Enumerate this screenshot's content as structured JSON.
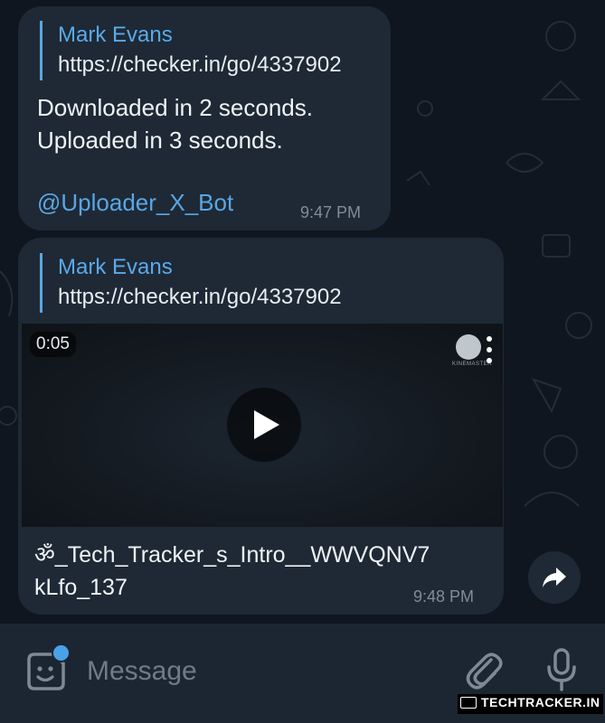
{
  "messages": [
    {
      "reply_name": "Mark Evans",
      "reply_link": "https://checker.in/go/4337902",
      "text": "Downloaded in 2 seconds.\nUploaded in 3 seconds.",
      "mention": "@Uploader_X_Bot",
      "time": "9:47 PM"
    },
    {
      "reply_name": "Mark Evans",
      "reply_link": "https://checker.in/go/4337902",
      "video": {
        "duration": "0:05",
        "watermark": "KINEMASTER",
        "icon": "play-icon"
      },
      "caption": "ॐ_Tech_Tracker_s_Intro__WWVQNV7\nkLfo_137",
      "time": "9:48 PM"
    }
  ],
  "composer": {
    "placeholder": "Message",
    "icons": [
      "sticker-icon",
      "attach-icon",
      "mic-icon"
    ]
  },
  "watermark": "TECHTRACKER.IN",
  "colors": {
    "background": "#0f1620",
    "bubble": "#1e2935",
    "accent": "#5aa6e3",
    "composer": "#1c2632"
  }
}
